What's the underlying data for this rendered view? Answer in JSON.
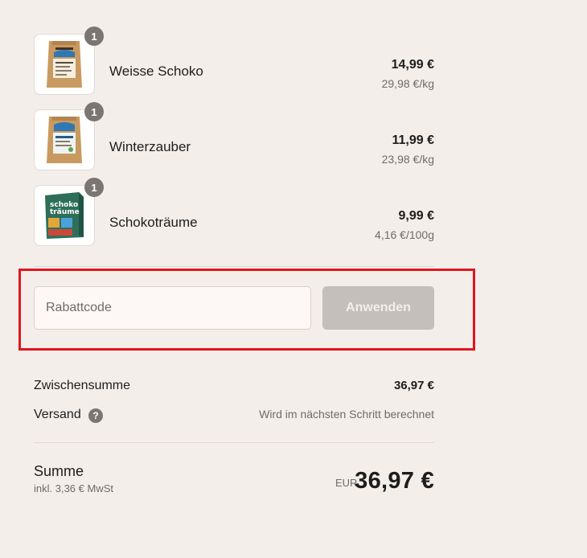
{
  "items": [
    {
      "name": "Weisse Schoko",
      "quantity": "1",
      "price": "14,99 €",
      "unit_price": "29,98 €/kg",
      "image": "kraft-pouch-white-label"
    },
    {
      "name": "Winterzauber",
      "quantity": "1",
      "price": "11,99 €",
      "unit_price": "23,98 €/kg",
      "image": "kraft-pouch-blue-label"
    },
    {
      "name": "Schokoträume",
      "quantity": "1",
      "price": "9,99 €",
      "unit_price": "4,16 €/100g",
      "image": "green-box",
      "box_text_line1": "schoko",
      "box_text_line2": "träume"
    }
  ],
  "discount": {
    "placeholder": "Rabattcode",
    "value": "",
    "apply_label": "Anwenden"
  },
  "summary": {
    "subtotal_label": "Zwischensumme",
    "subtotal_value": "36,97 €",
    "shipping_label": "Versand",
    "shipping_help_icon": "question-circle-icon",
    "shipping_value": "Wird im nächsten Schritt berechnet",
    "total_label": "Summe",
    "tax_note": "inkl. 3,36 € MwSt",
    "currency": "EUR",
    "total_value": "36,97 €"
  },
  "colors": {
    "background": "#f3eeea",
    "badge": "#7b7672",
    "button_disabled": "#c5bfbb",
    "highlight": "#e0161f"
  }
}
